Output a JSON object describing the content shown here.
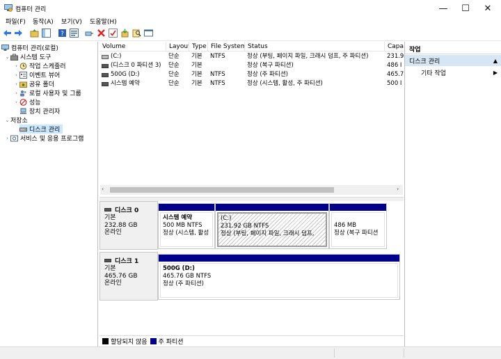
{
  "window": {
    "title": "컴퓨터 관리",
    "minimize": "—",
    "maximize": "☐",
    "close": "✕"
  },
  "menu": [
    "파일(F)",
    "동작(A)",
    "보기(V)",
    "도움말(H)"
  ],
  "toolbar": [
    "back-icon",
    "forward-icon",
    "folder-up-icon",
    "show-hide-tree-icon",
    "help-icon",
    "properties-icon",
    "connect-icon",
    "delete-icon",
    "check-icon",
    "import-icon",
    "search-icon",
    "console-icon"
  ],
  "tree": {
    "root": "컴퓨터 관리(로컬)",
    "items": [
      {
        "label": "시스템 도구",
        "level": 1,
        "expanded": true
      },
      {
        "label": "작업 스케줄러",
        "level": 2,
        "expandable": true
      },
      {
        "label": "이벤트 뷰어",
        "level": 2,
        "expandable": true
      },
      {
        "label": "공유 폴더",
        "level": 2,
        "expandable": true
      },
      {
        "label": "로컬 사용자 및 그룹",
        "level": 2,
        "expandable": true
      },
      {
        "label": "성능",
        "level": 2,
        "expandable": true
      },
      {
        "label": "장치 관리자",
        "level": 2,
        "expandable": false
      },
      {
        "label": "저장소",
        "level": 1,
        "expanded": true
      },
      {
        "label": "디스크 관리",
        "level": 2,
        "selected": true
      },
      {
        "label": "서비스 및 응용 프로그램",
        "level": 1,
        "expandable": true
      }
    ]
  },
  "volumes": {
    "columns": [
      "Volume",
      "Layout",
      "Type",
      "File System",
      "Status",
      "Capa"
    ],
    "rows": [
      [
        "(C:)",
        "단순",
        "기본",
        "NTFS",
        "정상 (부팅, 페이지 파일, 크래시 덤프, 주 파티션)",
        "231.9"
      ],
      [
        "(디스크 0 파티션 3)",
        "단순",
        "기본",
        "",
        "정상 (복구 파티션)",
        "486 I"
      ],
      [
        "500G (D:)",
        "단순",
        "기본",
        "NTFS",
        "정상 (주 파티션)",
        "465.7"
      ],
      [
        "시스템 예약",
        "단순",
        "기본",
        "NTFS",
        "정상 (시스템, 활성, 주 파티션)",
        "500 I"
      ]
    ]
  },
  "disks": [
    {
      "name": "디스크 0",
      "type": "기본",
      "size": "232.88 GB",
      "status": "온라인",
      "partitions": [
        {
          "name": "시스템 예약",
          "line2": "500 MB NTFS",
          "line3": "정상 (시스템, 활성"
        },
        {
          "name": "(C:)",
          "line2": "231.92 GB NTFS",
          "line3": "정상 (부팅, 페이지 파일, 크래시 덤프, ",
          "selected": true
        },
        {
          "name": "",
          "line2": "486 MB",
          "line3": "정상 (복구 파티션"
        }
      ]
    },
    {
      "name": "디스크 1",
      "type": "기본",
      "size": "465.76 GB",
      "status": "온라인",
      "partitions": [
        {
          "name": "500G  (D:)",
          "line2": "465.76 GB NTFS",
          "line3": "정상 (주 파티션)"
        }
      ]
    }
  ],
  "legend": [
    {
      "label": "할당되지 않음",
      "color": "#000000"
    },
    {
      "label": "주 파티션",
      "color": "#00008b"
    }
  ],
  "actions": {
    "header": "작업",
    "section": "디스크 관리",
    "more": "기타 작업"
  }
}
